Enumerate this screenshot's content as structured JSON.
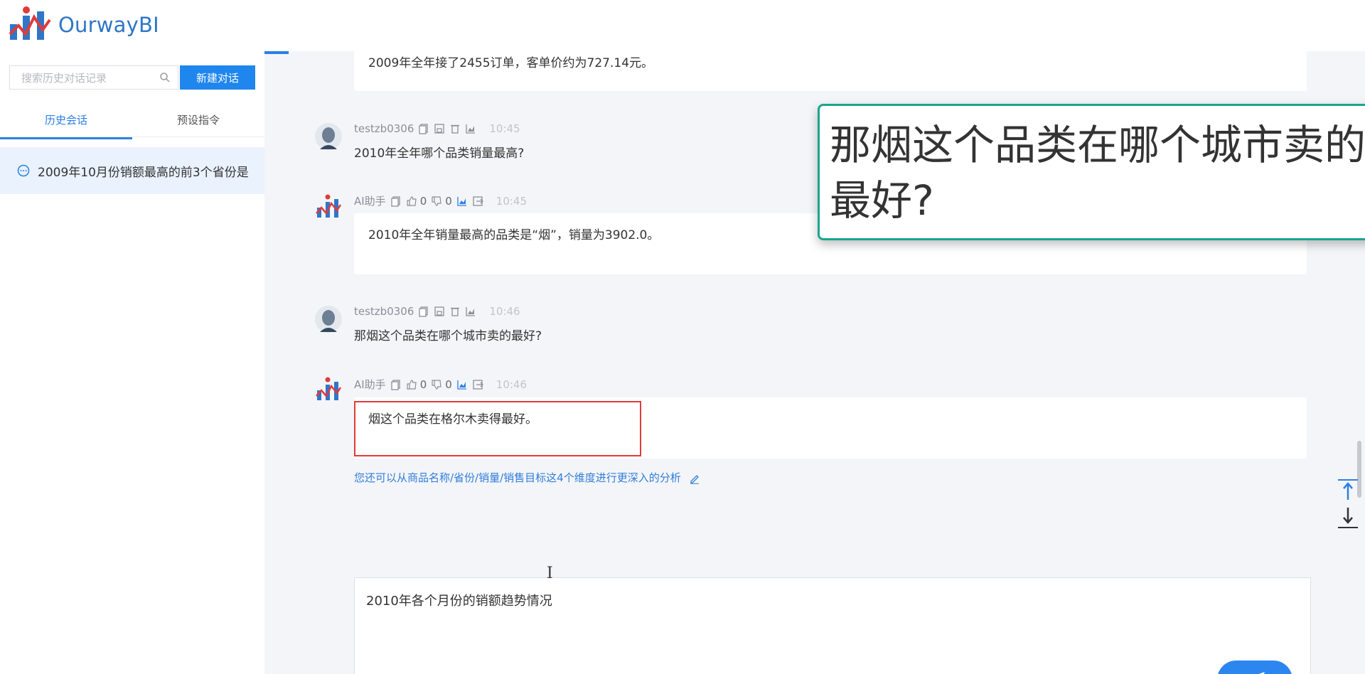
{
  "app": {
    "brand": "OurwayBI"
  },
  "sidebar": {
    "search_placeholder": "搜索历史对话记录",
    "new_chat_label": "新建对话",
    "tabs": [
      {
        "label": "历史会话",
        "active": true
      },
      {
        "label": "预设指令",
        "active": false
      }
    ],
    "history": [
      {
        "title": "2009年10月份销额最高的前3个省份是"
      }
    ]
  },
  "chat": {
    "top_partial_answer": "2009年全年接了2455订单，客单价约为727.14元。",
    "messages": [
      {
        "role": "user",
        "author": "testzb0306",
        "time": "10:45",
        "text": "2010年全年哪个品类销量最高?"
      },
      {
        "role": "ai",
        "author": "AI助手",
        "likes": "0",
        "dislikes": "0",
        "time": "10:45",
        "text": "2010年全年销量最高的品类是“烟”，销量为3902.0。"
      },
      {
        "role": "user",
        "author": "testzb0306",
        "time": "10:46",
        "text": "那烟这个品类在哪个城市卖的最好?"
      },
      {
        "role": "ai",
        "author": "AI助手",
        "likes": "0",
        "dislikes": "0",
        "time": "10:46",
        "text": "烟这个品类在格尔木卖得最好。"
      }
    ],
    "hint": "您还可以从商品名称/省份/销量/销售目标这4个维度进行更深入的分析",
    "callout_text": "那烟这个品类在哪个城市卖的最好?",
    "input_value": "2010年各个月份的销额趋势情况"
  },
  "colors": {
    "primary": "#1f86ee",
    "callout_border": "#1aa58f",
    "highlight": "#e23a3a"
  },
  "icons": [
    "logo-icon",
    "search-icon",
    "chat-bubble-icon",
    "copy-icon",
    "save-icon",
    "delete-icon",
    "chart-icon",
    "thumbs-up-icon",
    "thumbs-down-icon",
    "export-icon",
    "edit-icon",
    "send-icon",
    "scroll-top-icon",
    "scroll-bottom-icon"
  ]
}
